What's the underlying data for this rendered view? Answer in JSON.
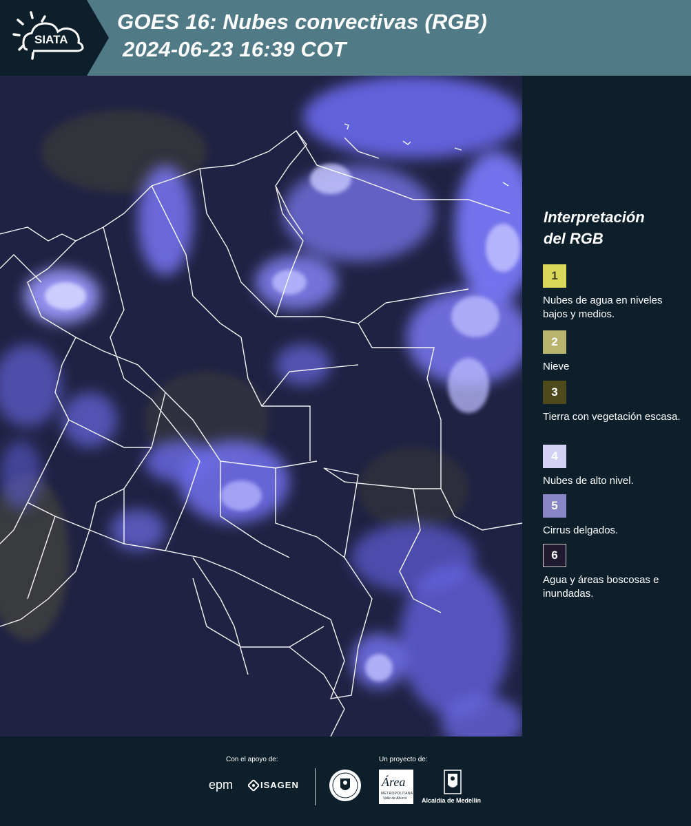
{
  "header": {
    "logo_text": "SIATA",
    "title_line1": "GOES 16: Nubes convectivas (RGB)",
    "title_line2": "2024-06-23 16:39 COT"
  },
  "colors": {
    "header_bg": "#4f7a86",
    "page_bg": "#0d1f2b",
    "map_base": "#1a1a3a",
    "cloud_high": "#6d6dff",
    "border_lines": "#ffffff"
  },
  "map": {
    "icon": "satellite-rgb-map"
  },
  "legend": {
    "title_line1": "Interpretación",
    "title_line2": "del RGB",
    "items": [
      {
        "number": "1",
        "label": "Nubes de agua en niveles bajos y medios.",
        "color": "#d9d65a",
        "text_color": "#444422"
      },
      {
        "number": "2",
        "label": "Nieve",
        "color": "#b8b46e",
        "text_color": "#ffffff"
      },
      {
        "number": "3",
        "label": "Tierra con vegetación escasa.",
        "color": "#4e4a1c",
        "text_color": "#ffffff"
      },
      {
        "number": "4",
        "label": "Nubes de alto nivel.",
        "color": "#d4d2f4",
        "text_color": "#ffffff"
      },
      {
        "number": "5",
        "label": "Cirrus delgados.",
        "color": "#8a86c6",
        "text_color": "#ffffff"
      },
      {
        "number": "6",
        "label": "Agua y áreas boscosas e inundadas.",
        "color": "#1f1a30",
        "text_color": "#ffffff"
      }
    ]
  },
  "footer": {
    "support_label": "Con el apoyo de:",
    "project_label": "Un proyecto de:",
    "sponsors": [
      "epm",
      "ISAGEN"
    ],
    "partners": [
      "Área Metropolitana Valle de Aburrá",
      "Alcaldía de Medellín"
    ],
    "area_logo_text": "Área",
    "area_sub_text": "METROPOLITANA",
    "area_sub_text2": "Valle de Aburrá",
    "alcaldia_text": "Alcaldía de Medellín"
  }
}
